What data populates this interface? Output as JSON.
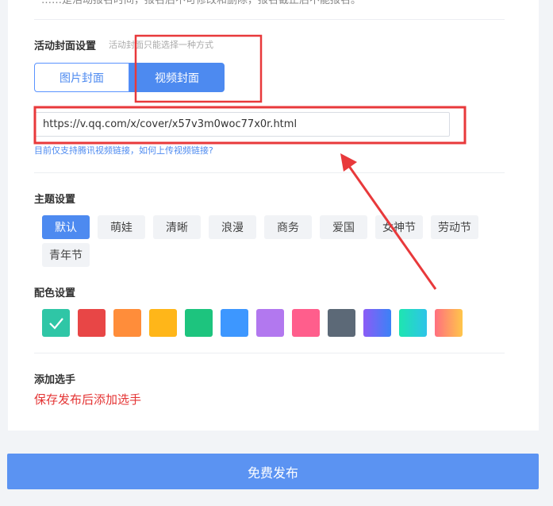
{
  "top_note": "……是活动报名时间，报名后不可修改和删除，报名截止后不能报名。",
  "cover": {
    "title": "活动封面设置",
    "hint": "活动封面只能选择一种方式",
    "options": [
      "图片封面",
      "视频封面"
    ],
    "selected": "视频封面",
    "video_url": "https://v.qq.com/x/cover/x57v3m0woc77x0r.html",
    "help_link": "目前仅支持腾讯视频链接，如何上传视频链接?"
  },
  "theme": {
    "title": "主题设置",
    "options": [
      "默认",
      "萌娃",
      "清晰",
      "浪漫",
      "商务",
      "爱国",
      "女神节",
      "劳动节",
      "青年节"
    ],
    "selected": "默认"
  },
  "color": {
    "title": "配色设置",
    "swatches": [
      {
        "name": "teal",
        "value": "#2fc6a6",
        "selected": true
      },
      {
        "name": "red",
        "value": "#e84646"
      },
      {
        "name": "orange",
        "value": "#ff8d3a"
      },
      {
        "name": "yellow",
        "value": "#ffb619"
      },
      {
        "name": "green",
        "value": "#1dc47e"
      },
      {
        "name": "blue",
        "value": "#3d97ff"
      },
      {
        "name": "purple",
        "value": "#b278ef"
      },
      {
        "name": "pink",
        "value": "#ff5e8c"
      },
      {
        "name": "slate",
        "value": "#5c6977"
      },
      {
        "name": "gradient-purple-blue",
        "value": "linear-gradient(90deg,#8b5cf6,#3b82f6)"
      },
      {
        "name": "gradient-cyan",
        "value": "linear-gradient(90deg,#1ee5b0,#2ec4e8)"
      },
      {
        "name": "gradient-pink-orange",
        "value": "linear-gradient(90deg,#ff6f7f,#ffc64a)"
      }
    ]
  },
  "players": {
    "title": "添加选手",
    "note": "保存发布后添加选手"
  },
  "publish_label": "免费发布",
  "annotation_color": "#e8393b"
}
